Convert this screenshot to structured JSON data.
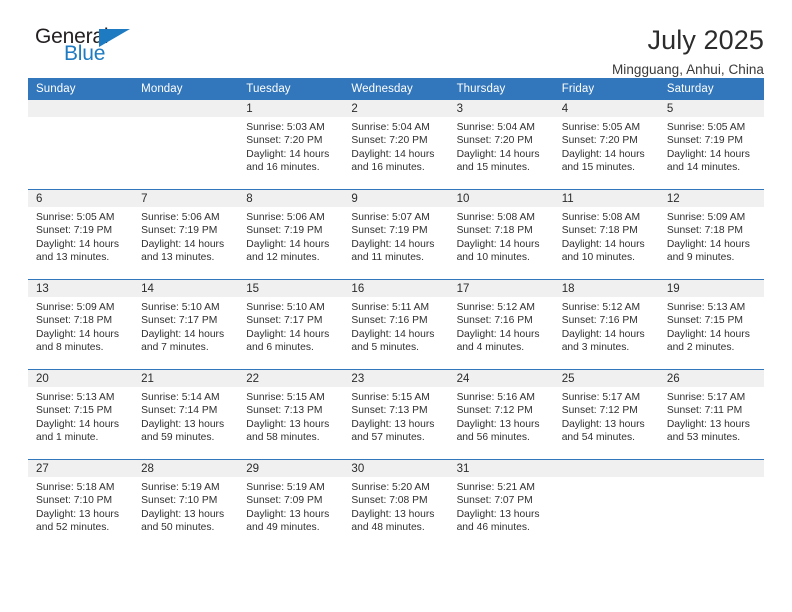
{
  "brand": {
    "name_top": "General",
    "name_bottom": "Blue",
    "accent_color": "#1f7bc1"
  },
  "header": {
    "title": "July 2025",
    "location": "Mingguang, Anhui, China"
  },
  "theme": {
    "header_blue": "#3276bb",
    "daynum_band": "#f0f0f0",
    "text": "#303030"
  },
  "calendar": {
    "weekday_headers": [
      "Sunday",
      "Monday",
      "Tuesday",
      "Wednesday",
      "Thursday",
      "Friday",
      "Saturday"
    ],
    "weeks": [
      [
        {
          "day": "",
          "sunrise": "",
          "sunset": "",
          "daylight_line1": "",
          "daylight_line2": ""
        },
        {
          "day": "",
          "sunrise": "",
          "sunset": "",
          "daylight_line1": "",
          "daylight_line2": ""
        },
        {
          "day": "1",
          "sunrise": "Sunrise: 5:03 AM",
          "sunset": "Sunset: 7:20 PM",
          "daylight_line1": "Daylight: 14 hours",
          "daylight_line2": "and 16 minutes."
        },
        {
          "day": "2",
          "sunrise": "Sunrise: 5:04 AM",
          "sunset": "Sunset: 7:20 PM",
          "daylight_line1": "Daylight: 14 hours",
          "daylight_line2": "and 16 minutes."
        },
        {
          "day": "3",
          "sunrise": "Sunrise: 5:04 AM",
          "sunset": "Sunset: 7:20 PM",
          "daylight_line1": "Daylight: 14 hours",
          "daylight_line2": "and 15 minutes."
        },
        {
          "day": "4",
          "sunrise": "Sunrise: 5:05 AM",
          "sunset": "Sunset: 7:20 PM",
          "daylight_line1": "Daylight: 14 hours",
          "daylight_line2": "and 15 minutes."
        },
        {
          "day": "5",
          "sunrise": "Sunrise: 5:05 AM",
          "sunset": "Sunset: 7:19 PM",
          "daylight_line1": "Daylight: 14 hours",
          "daylight_line2": "and 14 minutes."
        }
      ],
      [
        {
          "day": "6",
          "sunrise": "Sunrise: 5:05 AM",
          "sunset": "Sunset: 7:19 PM",
          "daylight_line1": "Daylight: 14 hours",
          "daylight_line2": "and 13 minutes."
        },
        {
          "day": "7",
          "sunrise": "Sunrise: 5:06 AM",
          "sunset": "Sunset: 7:19 PM",
          "daylight_line1": "Daylight: 14 hours",
          "daylight_line2": "and 13 minutes."
        },
        {
          "day": "8",
          "sunrise": "Sunrise: 5:06 AM",
          "sunset": "Sunset: 7:19 PM",
          "daylight_line1": "Daylight: 14 hours",
          "daylight_line2": "and 12 minutes."
        },
        {
          "day": "9",
          "sunrise": "Sunrise: 5:07 AM",
          "sunset": "Sunset: 7:19 PM",
          "daylight_line1": "Daylight: 14 hours",
          "daylight_line2": "and 11 minutes."
        },
        {
          "day": "10",
          "sunrise": "Sunrise: 5:08 AM",
          "sunset": "Sunset: 7:18 PM",
          "daylight_line1": "Daylight: 14 hours",
          "daylight_line2": "and 10 minutes."
        },
        {
          "day": "11",
          "sunrise": "Sunrise: 5:08 AM",
          "sunset": "Sunset: 7:18 PM",
          "daylight_line1": "Daylight: 14 hours",
          "daylight_line2": "and 10 minutes."
        },
        {
          "day": "12",
          "sunrise": "Sunrise: 5:09 AM",
          "sunset": "Sunset: 7:18 PM",
          "daylight_line1": "Daylight: 14 hours",
          "daylight_line2": "and 9 minutes."
        }
      ],
      [
        {
          "day": "13",
          "sunrise": "Sunrise: 5:09 AM",
          "sunset": "Sunset: 7:18 PM",
          "daylight_line1": "Daylight: 14 hours",
          "daylight_line2": "and 8 minutes."
        },
        {
          "day": "14",
          "sunrise": "Sunrise: 5:10 AM",
          "sunset": "Sunset: 7:17 PM",
          "daylight_line1": "Daylight: 14 hours",
          "daylight_line2": "and 7 minutes."
        },
        {
          "day": "15",
          "sunrise": "Sunrise: 5:10 AM",
          "sunset": "Sunset: 7:17 PM",
          "daylight_line1": "Daylight: 14 hours",
          "daylight_line2": "and 6 minutes."
        },
        {
          "day": "16",
          "sunrise": "Sunrise: 5:11 AM",
          "sunset": "Sunset: 7:16 PM",
          "daylight_line1": "Daylight: 14 hours",
          "daylight_line2": "and 5 minutes."
        },
        {
          "day": "17",
          "sunrise": "Sunrise: 5:12 AM",
          "sunset": "Sunset: 7:16 PM",
          "daylight_line1": "Daylight: 14 hours",
          "daylight_line2": "and 4 minutes."
        },
        {
          "day": "18",
          "sunrise": "Sunrise: 5:12 AM",
          "sunset": "Sunset: 7:16 PM",
          "daylight_line1": "Daylight: 14 hours",
          "daylight_line2": "and 3 minutes."
        },
        {
          "day": "19",
          "sunrise": "Sunrise: 5:13 AM",
          "sunset": "Sunset: 7:15 PM",
          "daylight_line1": "Daylight: 14 hours",
          "daylight_line2": "and 2 minutes."
        }
      ],
      [
        {
          "day": "20",
          "sunrise": "Sunrise: 5:13 AM",
          "sunset": "Sunset: 7:15 PM",
          "daylight_line1": "Daylight: 14 hours",
          "daylight_line2": "and 1 minute."
        },
        {
          "day": "21",
          "sunrise": "Sunrise: 5:14 AM",
          "sunset": "Sunset: 7:14 PM",
          "daylight_line1": "Daylight: 13 hours",
          "daylight_line2": "and 59 minutes."
        },
        {
          "day": "22",
          "sunrise": "Sunrise: 5:15 AM",
          "sunset": "Sunset: 7:13 PM",
          "daylight_line1": "Daylight: 13 hours",
          "daylight_line2": "and 58 minutes."
        },
        {
          "day": "23",
          "sunrise": "Sunrise: 5:15 AM",
          "sunset": "Sunset: 7:13 PM",
          "daylight_line1": "Daylight: 13 hours",
          "daylight_line2": "and 57 minutes."
        },
        {
          "day": "24",
          "sunrise": "Sunrise: 5:16 AM",
          "sunset": "Sunset: 7:12 PM",
          "daylight_line1": "Daylight: 13 hours",
          "daylight_line2": "and 56 minutes."
        },
        {
          "day": "25",
          "sunrise": "Sunrise: 5:17 AM",
          "sunset": "Sunset: 7:12 PM",
          "daylight_line1": "Daylight: 13 hours",
          "daylight_line2": "and 54 minutes."
        },
        {
          "day": "26",
          "sunrise": "Sunrise: 5:17 AM",
          "sunset": "Sunset: 7:11 PM",
          "daylight_line1": "Daylight: 13 hours",
          "daylight_line2": "and 53 minutes."
        }
      ],
      [
        {
          "day": "27",
          "sunrise": "Sunrise: 5:18 AM",
          "sunset": "Sunset: 7:10 PM",
          "daylight_line1": "Daylight: 13 hours",
          "daylight_line2": "and 52 minutes."
        },
        {
          "day": "28",
          "sunrise": "Sunrise: 5:19 AM",
          "sunset": "Sunset: 7:10 PM",
          "daylight_line1": "Daylight: 13 hours",
          "daylight_line2": "and 50 minutes."
        },
        {
          "day": "29",
          "sunrise": "Sunrise: 5:19 AM",
          "sunset": "Sunset: 7:09 PM",
          "daylight_line1": "Daylight: 13 hours",
          "daylight_line2": "and 49 minutes."
        },
        {
          "day": "30",
          "sunrise": "Sunrise: 5:20 AM",
          "sunset": "Sunset: 7:08 PM",
          "daylight_line1": "Daylight: 13 hours",
          "daylight_line2": "and 48 minutes."
        },
        {
          "day": "31",
          "sunrise": "Sunrise: 5:21 AM",
          "sunset": "Sunset: 7:07 PM",
          "daylight_line1": "Daylight: 13 hours",
          "daylight_line2": "and 46 minutes."
        },
        {
          "day": "",
          "sunrise": "",
          "sunset": "",
          "daylight_line1": "",
          "daylight_line2": ""
        },
        {
          "day": "",
          "sunrise": "",
          "sunset": "",
          "daylight_line1": "",
          "daylight_line2": ""
        }
      ]
    ]
  }
}
